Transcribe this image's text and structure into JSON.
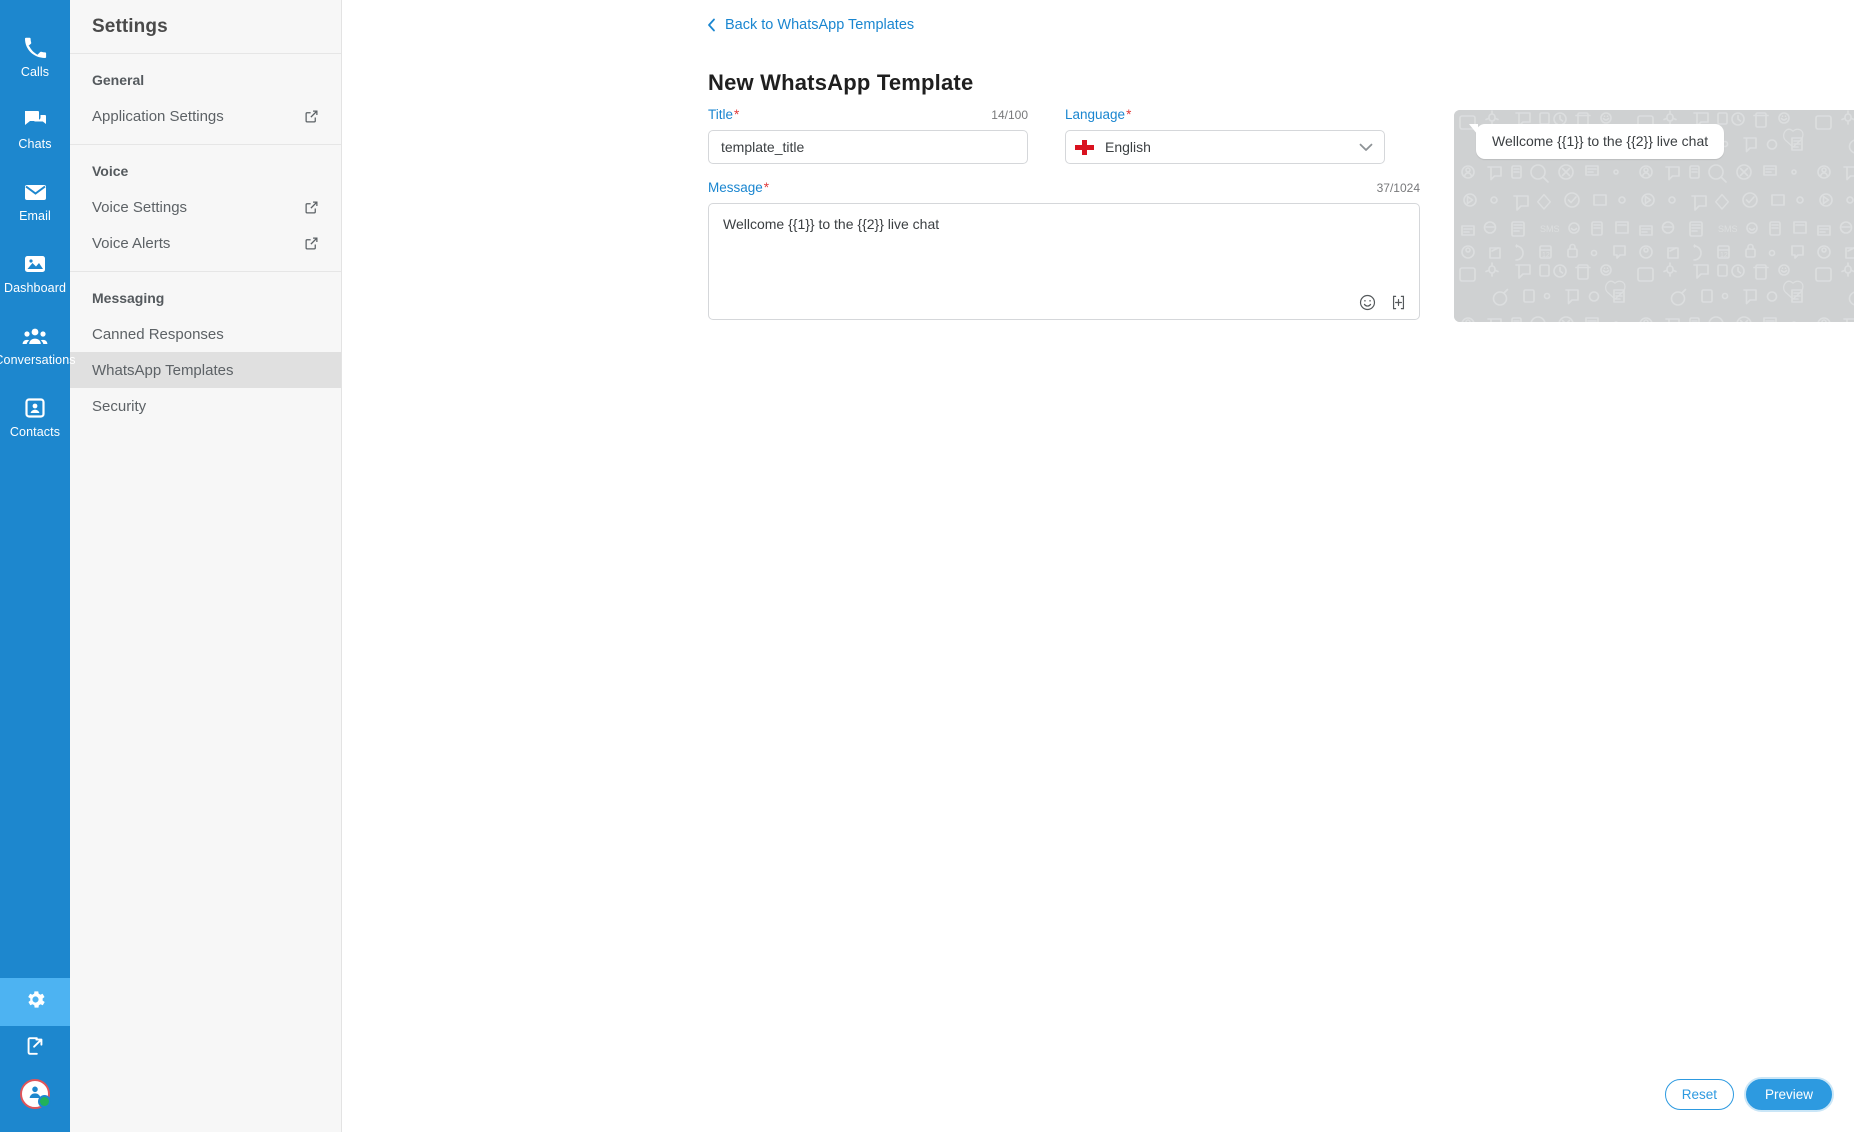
{
  "rail": {
    "items": [
      {
        "label": "Calls",
        "icon": "phone-icon"
      },
      {
        "label": "Chats",
        "icon": "chat-bubbles-icon"
      },
      {
        "label": "Email",
        "icon": "envelope-icon"
      },
      {
        "label": "Dashboard",
        "icon": "image-chart-icon"
      },
      {
        "label": "Conversations",
        "icon": "people-group-icon"
      },
      {
        "label": "Contacts",
        "icon": "contact-card-icon"
      }
    ],
    "bottom": {
      "settings_icon": "gear-icon",
      "logout_icon": "logout-icon",
      "avatar_icon": "user-avatar-icon",
      "presence": "online"
    },
    "accent": "#1d87ce",
    "active_bg": "#4db3f2"
  },
  "settings": {
    "title": "Settings",
    "sections": [
      {
        "title": "General",
        "items": [
          {
            "label": "Application Settings",
            "external": true,
            "active": false
          }
        ]
      },
      {
        "title": "Voice",
        "items": [
          {
            "label": "Voice Settings",
            "external": true,
            "active": false
          },
          {
            "label": "Voice Alerts",
            "external": true,
            "active": false
          }
        ]
      },
      {
        "title": "Messaging",
        "items": [
          {
            "label": "Canned Responses",
            "external": false,
            "active": false
          },
          {
            "label": "WhatsApp Templates",
            "external": false,
            "active": true
          },
          {
            "label": "Security",
            "external": false,
            "active": false
          }
        ]
      }
    ]
  },
  "main": {
    "back_link": "Back to WhatsApp Templates",
    "page_title": "New WhatsApp Template",
    "title_field": {
      "label": "Title",
      "required": "*",
      "counter": "14/100",
      "value": "template_title",
      "placeholder": ""
    },
    "language_field": {
      "label": "Language",
      "required": "*",
      "value": "English",
      "flag": "england-flag-icon"
    },
    "message_field": {
      "label": "Message",
      "required": "*",
      "counter": "37/1024",
      "value": "Wellcome {{1}} to the {{2}} live chat",
      "placeholder": "",
      "emoji_icon": "emoji-smiley-icon",
      "placeholder_icon": "insert-placeholder-icon"
    },
    "preview": {
      "bubble_text": "Wellcome {{1}} to the {{2}} live chat",
      "background": "#cfd1d2"
    },
    "buttons": {
      "reset": "Reset",
      "preview": "Preview"
    }
  },
  "colors": {
    "link": "#1a86d0",
    "required": "#e03b3b",
    "primary": "#2d9ae0"
  }
}
